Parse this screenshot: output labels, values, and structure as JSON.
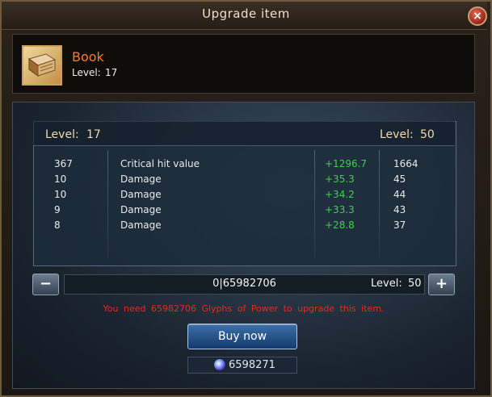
{
  "window": {
    "title": "Upgrade item",
    "close_icon": "×"
  },
  "item": {
    "name": "Book",
    "level_label": "Level:",
    "level_value": "17",
    "icon": "book-icon"
  },
  "stats": {
    "current_level_label": "Level:",
    "current_level_value": "17",
    "target_level_label": "Level:",
    "target_level_value": "50",
    "rows": [
      {
        "base": "367",
        "name": "Critical hit value",
        "bonus": "+1296.7",
        "result": "1664"
      },
      {
        "base": "10",
        "name": "Damage",
        "bonus": "+35.3",
        "result": "45"
      },
      {
        "base": "10",
        "name": "Damage",
        "bonus": "+34.2",
        "result": "44"
      },
      {
        "base": "9",
        "name": "Damage",
        "bonus": "+33.3",
        "result": "43"
      },
      {
        "base": "8",
        "name": "Damage",
        "bonus": "+28.8",
        "result": "37"
      }
    ]
  },
  "quantity": {
    "minus_label": "−",
    "plus_label": "+",
    "value": "0|65982706",
    "level_label": "Level:",
    "level_value": "50"
  },
  "warning": "You need 65982706 Glyphs of Power to upgrade this item.",
  "buy_button": "Buy now",
  "currency": {
    "icon": "glyph-of-power-icon",
    "value": "6598271"
  },
  "colors": {
    "item_name": "#ff7a1e",
    "bonus": "#3ad447",
    "warning": "#e62a1e",
    "level_text": "#f6d9a5"
  }
}
